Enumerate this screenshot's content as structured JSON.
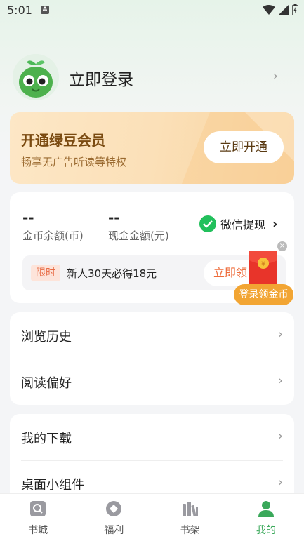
{
  "status_bar": {
    "time": "5:01",
    "notification_icon": "A"
  },
  "profile": {
    "login_label": "立即登录",
    "avatar_icon": "bean-mascot-icon"
  },
  "vip": {
    "title": "开通绿豆会员",
    "subtitle": "畅享无广告听读等特权",
    "button_label": "立即开通"
  },
  "wallet": {
    "coin_value": "--",
    "coin_label": "金币余额(币)",
    "cash_value": "--",
    "cash_label": "现金金额(元)",
    "wechat_label": "微信提现",
    "promo_badge": "限时",
    "promo_text": "新人30天必得18元",
    "promo_button": "立即领",
    "redpack_label": "登录领金币"
  },
  "menu_group_1": [
    {
      "label": "浏览历史"
    },
    {
      "label": "阅读偏好"
    }
  ],
  "menu_group_2": [
    {
      "label": "我的下载"
    },
    {
      "label": "桌面小组件"
    }
  ],
  "tabs": [
    {
      "label": "书城",
      "icon": "bookstore-icon"
    },
    {
      "label": "福利",
      "icon": "welfare-icon"
    },
    {
      "label": "书架",
      "icon": "bookshelf-icon"
    },
    {
      "label": "我的",
      "icon": "profile-icon",
      "active": true
    }
  ],
  "colors": {
    "accent": "#3aa85a",
    "promo": "#ee6b3a",
    "vip_text": "#7a4a10"
  }
}
